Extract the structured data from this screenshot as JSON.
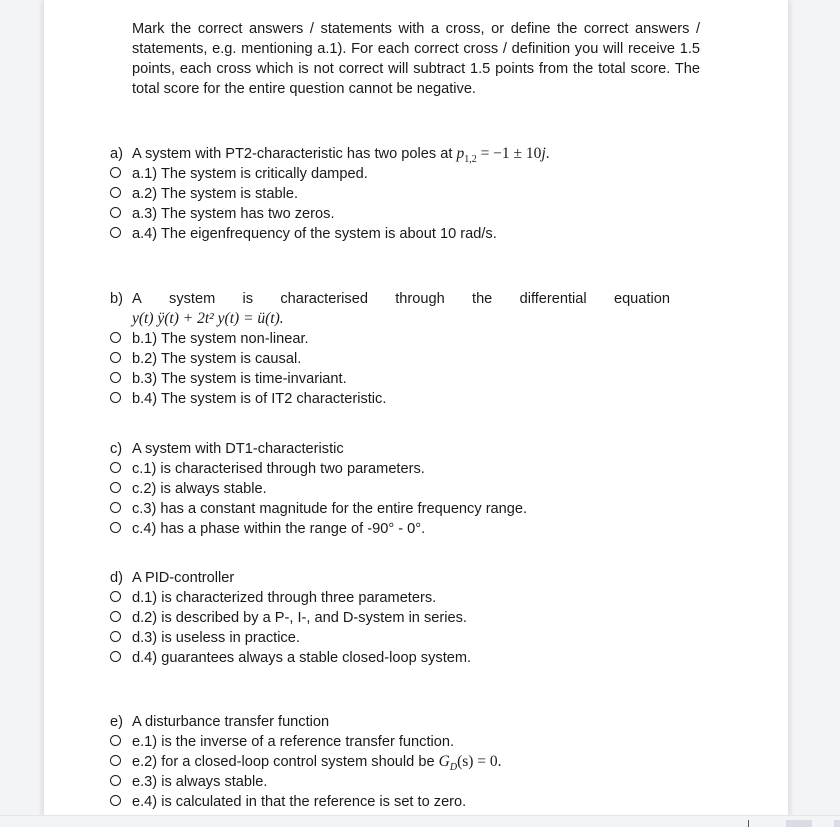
{
  "intro": "Mark the correct answers / statements with a cross, or define the correct answers / statements, e.g. mentioning a.1). For each correct cross / definition you will receive 1.5 points, each cross which is not correct will subtract 1.5 points from the total score. The total score for the entire question cannot be negative.",
  "questions": [
    {
      "letter": "a)",
      "stem": "A system with PT2-characteristic has two poles at",
      "math": {
        "var": "p",
        "sub": "1,2",
        "rest": " = −1 ± 10",
        "tail_var": "j",
        "end": "."
      },
      "options": [
        {
          "label": "a.1) The system is critically damped.",
          "checked": false
        },
        {
          "label": "a.2) The system is stable.",
          "checked": false
        },
        {
          "label": "a.3) The system has two zeros.",
          "checked": false
        },
        {
          "label": "a.4) The eigenfrequency of the system is about 10 rad/s.",
          "checked": false
        }
      ]
    },
    {
      "letter": "b)",
      "stem_words": [
        "A",
        "system",
        "is",
        "characterised",
        "through",
        "the",
        "differential",
        "equation"
      ],
      "equation": "y(t) ÿ(t) + 2t² y(t) = ü(t).",
      "options": [
        {
          "label": "b.1) The system non-linear.",
          "checked": false
        },
        {
          "label": "b.2) The system is causal.",
          "checked": false
        },
        {
          "label": "b.3) The system is time-invariant.",
          "checked": false
        },
        {
          "label": "b.4) The system is of IT2 characteristic.",
          "checked": false
        }
      ]
    },
    {
      "letter": "c)",
      "stem": "A system with DT1-characteristic",
      "options": [
        {
          "label": "c.1) is characterised through two parameters.",
          "checked": false
        },
        {
          "label": "c.2) is always stable.",
          "checked": false
        },
        {
          "label": "c.3) has a constant magnitude for the entire frequency range.",
          "checked": false
        },
        {
          "label": "c.4) has a phase within the range of -90° - 0°.",
          "checked": false
        }
      ]
    },
    {
      "letter": "d)",
      "stem": "A PID-controller",
      "options": [
        {
          "label": "d.1) is characterized through three parameters.",
          "checked": false
        },
        {
          "label": "d.2) is described by a P-, I-, and D-system in series.",
          "checked": false
        },
        {
          "label": "d.3) is useless in practice.",
          "checked": false
        },
        {
          "label": "d.4) guarantees always a stable closed-loop system.",
          "checked": false
        }
      ]
    },
    {
      "letter": "e)",
      "stem": "A disturbance transfer function",
      "options": [
        {
          "label": "e.1) is the inverse of a reference transfer function.",
          "checked": false
        },
        {
          "label": "e.2) for a closed-loop control system should be",
          "math": "G_D(s) = 0.",
          "checked": false
        },
        {
          "label": "e.3) is always stable.",
          "checked": false
        },
        {
          "label": "e.4) is calculated in that the reference is set to zero.",
          "checked": false
        }
      ]
    }
  ]
}
